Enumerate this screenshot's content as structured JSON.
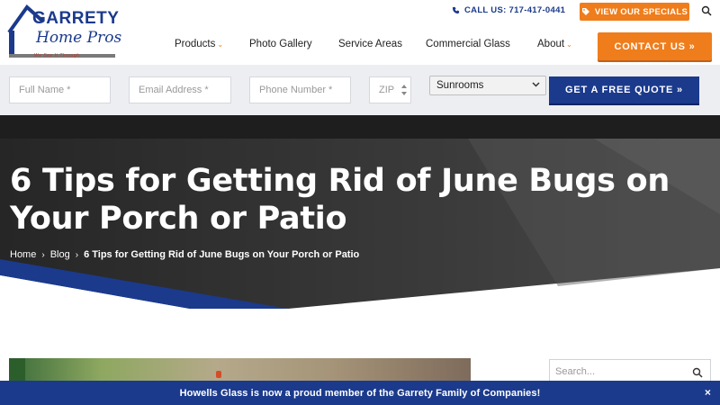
{
  "logo": {
    "name": "GARRETY",
    "sub": "Home Pros",
    "tag": "We See It Through"
  },
  "header": {
    "call_label": "CALL US: 717-417-0441",
    "specials_label": "VIEW OUR SPECIALS",
    "contact_label": "CONTACT US »",
    "nav": [
      {
        "label": "Products",
        "has_caret": true
      },
      {
        "label": "Photo Gallery",
        "has_caret": false
      },
      {
        "label": "Service Areas",
        "has_caret": false
      },
      {
        "label": "Commercial Glass",
        "has_caret": false
      },
      {
        "label": "About",
        "has_caret": true
      }
    ],
    "caret_glyph": "⌄"
  },
  "quote": {
    "full_name_placeholder": "Full Name *",
    "email_placeholder": "Email Address *",
    "phone_placeholder": "Phone Number *",
    "zip_placeholder": "ZIP",
    "product_selected": "Sunrooms",
    "submit_label": "GET A FREE QUOTE »"
  },
  "hero": {
    "title": "6 Tips for Getting Rid of June Bugs on Your Porch or Patio",
    "breadcrumb": [
      {
        "label": "Home"
      },
      {
        "label": "Blog"
      },
      {
        "label": "6 Tips for Getting Rid of June Bugs on Your Porch or Patio"
      }
    ],
    "separator": "›"
  },
  "sidebar": {
    "search_placeholder": "Search..."
  },
  "banner": {
    "text": "Howells Glass is now a proud member of the Garrety Family of Companies!",
    "close_glyph": "×"
  },
  "colors": {
    "brand_blue": "#1b3a8c",
    "accent_orange": "#ef7d1b",
    "hero_dark": "#2a2a2a"
  },
  "icons": [
    "phone-icon",
    "tag-icon",
    "search-icon",
    "chevron-down-icon",
    "close-icon"
  ]
}
